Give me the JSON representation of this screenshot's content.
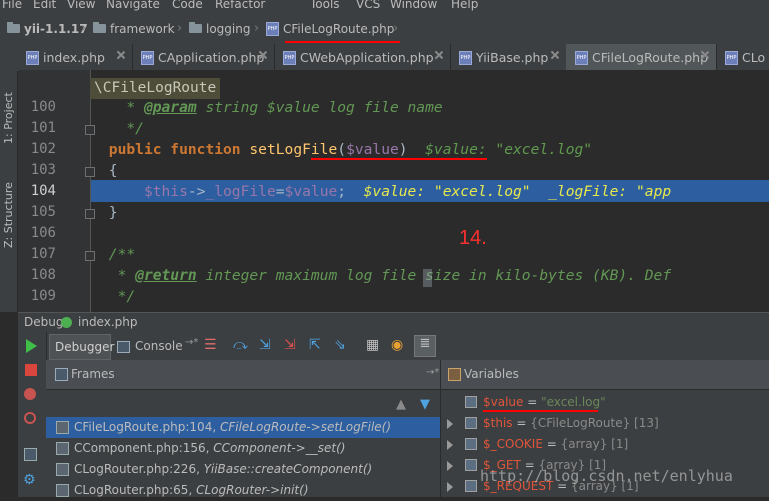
{
  "menu": [
    "File",
    "Edit",
    "View",
    "Navigate",
    "Code",
    "Refactor",
    "Tools",
    "VCS",
    "Window",
    "Help"
  ],
  "breadcrumb": {
    "project": "yii-1.1.17",
    "items": [
      "framework",
      "logging",
      "CFileLogRoute.php"
    ]
  },
  "tabs": [
    "index.php",
    "CApplication.php",
    "CWebApplication.php",
    "YiiBase.php",
    "CFileLogRoute.php",
    "CLo"
  ],
  "left_strip": {
    "project": "1: Project",
    "structure": "Z: Structure"
  },
  "editor": {
    "class_hint": "\\CFileLogRoute",
    "lines": [
      {
        "num": "100",
        "text": "    * @param string $value log file name"
      },
      {
        "num": "101",
        "text": "    */"
      },
      {
        "num": "102",
        "text": "  public function setLogFile($value)"
      },
      {
        "num": "103",
        "text": "  {"
      },
      {
        "num": "104",
        "text": "      $this->_logFile=$value;"
      },
      {
        "num": "105",
        "text": "  }"
      },
      {
        "num": "106",
        "text": ""
      },
      {
        "num": "107",
        "text": "  /**"
      },
      {
        "num": "108",
        "text": "   * @return integer maximum log file size in kilo-bytes (KB). Def"
      },
      {
        "num": "109",
        "text": "   */"
      }
    ],
    "inline_102": "$value: \"excel.log\"",
    "inline_104": "$value: \"excel.log\"  _logFile: \"app",
    "step_marker": "14."
  },
  "debug": {
    "label": "Debug",
    "config": "index.php",
    "tabs": {
      "debugger": "Debugger",
      "console": "Console"
    },
    "frames": {
      "title": "Frames",
      "rows": [
        {
          "file": "CFileLogRoute.php:104,",
          "method": "CFileLogRoute->setLogFile()"
        },
        {
          "file": "CComponent.php:156,",
          "method": "CComponent->__set()"
        },
        {
          "file": "CLogRouter.php:226,",
          "method": "YiiBase::createComponent()"
        },
        {
          "file": "CLogRouter.php:65,",
          "method": "CLogRouter->init()"
        }
      ]
    },
    "variables": {
      "title": "Variables",
      "rows": [
        {
          "name": "$value",
          "eq": " = ",
          "value": "\"excel.log\""
        },
        {
          "name": "$this",
          "eq": " = ",
          "value": "{CFileLogRoute} [13]"
        },
        {
          "name": "$_COOKIE",
          "eq": " = ",
          "value": "{array} [1]"
        },
        {
          "name": "$_GET",
          "eq": " = ",
          "value": "{array} [1]"
        },
        {
          "name": "$_REQUEST",
          "eq": " = ",
          "value": "{array} [1]"
        }
      ]
    }
  },
  "watermark": "http://blog.csdn.net/enlyhua",
  "colors": {
    "highlight": "#2d5fa0",
    "annotation": "#ff0000",
    "accent": "#cc7832"
  }
}
